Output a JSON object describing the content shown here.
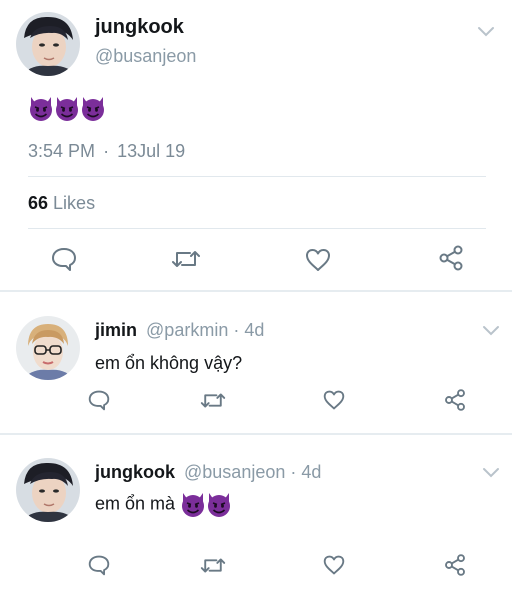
{
  "main_tweet": {
    "display_name": "jungkook",
    "handle": "@busanjeon",
    "emoji_icons": [
      "smiling-devil-icon",
      "smiling-devil-icon",
      "smiling-devil-icon"
    ],
    "time": "3:54 PM",
    "separator": "·",
    "date": "13Jul 19",
    "likes_count": "66",
    "likes_label": "Likes"
  },
  "replies": [
    {
      "display_name": "jimin",
      "handle": "@parkmin",
      "separator": "·",
      "age": "4d",
      "text": "em ổn không vậy?"
    },
    {
      "display_name": "jungkook",
      "handle": "@busanjeon",
      "separator": "·",
      "age": "4d",
      "text": "em ổn mà",
      "emoji_icons": [
        "smiling-devil-icon",
        "smiling-devil-icon"
      ]
    }
  ],
  "icons": {
    "reply": "speech-bubble-icon",
    "retweet": "retweet-icon",
    "like": "heart-icon",
    "share": "share-icon",
    "menu": "chevron-down-icon"
  },
  "colors": {
    "icon_gray": "#697985",
    "handle_gray": "#8a9aa6",
    "divider": "#e1e8ed",
    "devil_purple": "#7b2e9a"
  }
}
